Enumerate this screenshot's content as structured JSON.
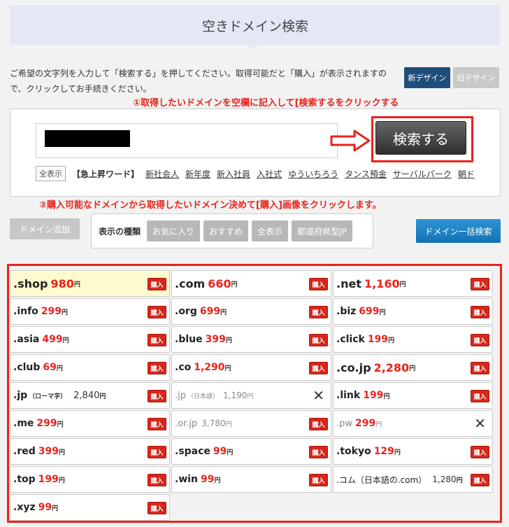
{
  "header": {
    "title": "空きドメイン検索"
  },
  "intro": {
    "text": "ご希望の文字列を入力して「検索する」を押してください。取得可能だと「購入」が表示されますので、クリックしてお手続きください。"
  },
  "design": {
    "new_label": "新デザイン",
    "old_label": "旧デザイン"
  },
  "annotations": {
    "step1": "①取得したいドメインを空欄に記入して[検索するをクリックする",
    "step2": "②購入可能なドメインから取得したいドメイン決めて[購入]画像をクリックします。"
  },
  "search": {
    "button_label": "検索する",
    "show_all_label": "全表示"
  },
  "keywords": {
    "label": "【急上昇ワード】",
    "items": [
      "新社会人",
      "新年度",
      "新入社員",
      "入社式",
      "ゆういちろう",
      "タンス預金",
      "サーバルパーク",
      "朝ド"
    ]
  },
  "controls": {
    "domain_add_label": "ドメイン追加",
    "kind_label": "表示の種類",
    "kind_buttons": [
      "お気に入り",
      "おすすめ",
      "全表示",
      "都道府県型JP"
    ],
    "bulk_search_label": "ドメイン一括検索"
  },
  "buy_label": "購入",
  "yen_label": "円",
  "domains": [
    {
      "tld": ".shop",
      "price": "980"
    },
    {
      "tld": ".com",
      "price": "660"
    },
    {
      "tld": ".net",
      "price": "1,160"
    },
    {
      "tld": ".info",
      "price": "299"
    },
    {
      "tld": ".org",
      "price": "699"
    },
    {
      "tld": ".biz",
      "price": "699"
    },
    {
      "tld": ".asia",
      "price": "499"
    },
    {
      "tld": ".blue",
      "price": "399"
    },
    {
      "tld": ".click",
      "price": "199"
    },
    {
      "tld": ".club",
      "price": "69"
    },
    {
      "tld": ".co",
      "price": "1,290"
    },
    {
      "tld": ".co.jp",
      "price": "2,280"
    },
    {
      "tld": ".jp",
      "note": "（ローマ字）",
      "price": "2,840"
    },
    {
      "tld": ".jp",
      "note": "（日本語）",
      "price": "1,190"
    },
    {
      "tld": ".link",
      "price": "199"
    },
    {
      "tld": ".me",
      "price": "299"
    },
    {
      "tld": ".or.jp",
      "price": "3,780"
    },
    {
      "tld": ".pw",
      "price": "299"
    },
    {
      "tld": ".red",
      "price": "399"
    },
    {
      "tld": ".space",
      "price": "99"
    },
    {
      "tld": ".tokyo",
      "price": "129"
    },
    {
      "tld": ".top",
      "price": "199"
    },
    {
      "tld": ".win",
      "price": "99"
    },
    {
      "tld": ".コム（日本語の.com）",
      "price": "1,280"
    },
    {
      "tld": ".xyz",
      "price": "99"
    }
  ]
}
